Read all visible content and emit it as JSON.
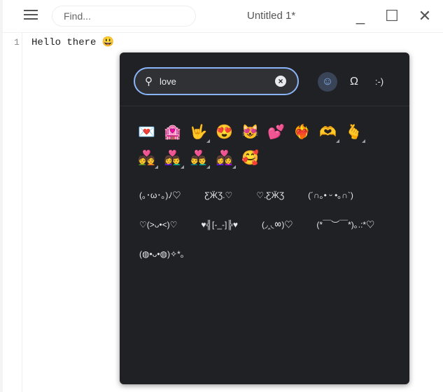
{
  "window": {
    "title": "Untitled 1*",
    "find_placeholder": "Find...",
    "minimize": "_",
    "maximize": "☐",
    "close": "✕"
  },
  "editor": {
    "line_number": "1",
    "text": "Hello there 😃"
  },
  "picker": {
    "search_value": "love",
    "categories": [
      {
        "name": "emoji",
        "glyph": "☺"
      },
      {
        "name": "symbols",
        "glyph": "Ω"
      },
      {
        "name": "emoticons",
        "glyph": ":-)"
      }
    ],
    "emojis": [
      {
        "char": "💌",
        "variants": false
      },
      {
        "char": "🏩",
        "variants": false
      },
      {
        "char": "🤟",
        "variants": true
      },
      {
        "char": "😍",
        "variants": false
      },
      {
        "char": "😻",
        "variants": false
      },
      {
        "char": "💕",
        "variants": false
      },
      {
        "char": "❤️‍🔥",
        "variants": false
      },
      {
        "char": "🫶",
        "variants": true
      },
      {
        "char": "🫰",
        "variants": true
      },
      {
        "char": "💑",
        "variants": true
      },
      {
        "char": "👩‍❤️‍👨",
        "variants": true
      },
      {
        "char": "👨‍❤️‍👨",
        "variants": true
      },
      {
        "char": "👩‍❤️‍👩",
        "variants": true
      },
      {
        "char": "🥰",
        "variants": false
      }
    ],
    "emoticons": [
      "(｡･ω･｡)ﾉ♡",
      "ƸӜƷ.♡",
      "♡.ƸӜƷ",
      "(´∩｡• ᵕ •｡∩`)",
      "♡(>ᴗ•<)♡",
      "♥╣[-_-]╠♥",
      "(◞‸◟ㆀ)♡",
      "(*￣︶￣*)｡.:*♡",
      "(◍•ᴗ•◍)✧*｡"
    ]
  }
}
